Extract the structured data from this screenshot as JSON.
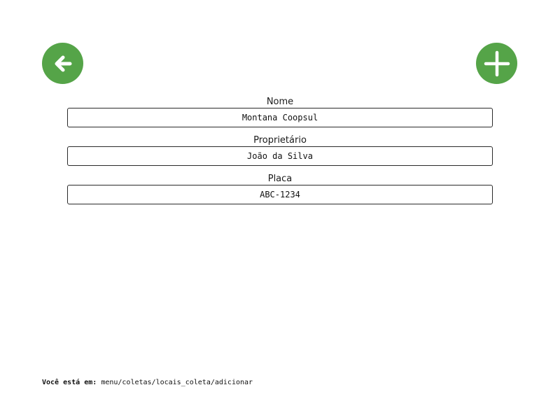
{
  "header": {
    "back_icon": "arrow-left-icon",
    "add_icon": "plus-icon",
    "button_color": "#55a448"
  },
  "form": {
    "nome": {
      "label": "Nome",
      "value": "Montana Coopsul"
    },
    "proprietario": {
      "label": "Proprietário",
      "value": "João da Silva"
    },
    "placa": {
      "label": "Placa",
      "value": "ABC-1234"
    }
  },
  "breadcrumb": {
    "label": "Você está em:",
    "path": "menu/coletas/locais_coleta/adicionar"
  }
}
